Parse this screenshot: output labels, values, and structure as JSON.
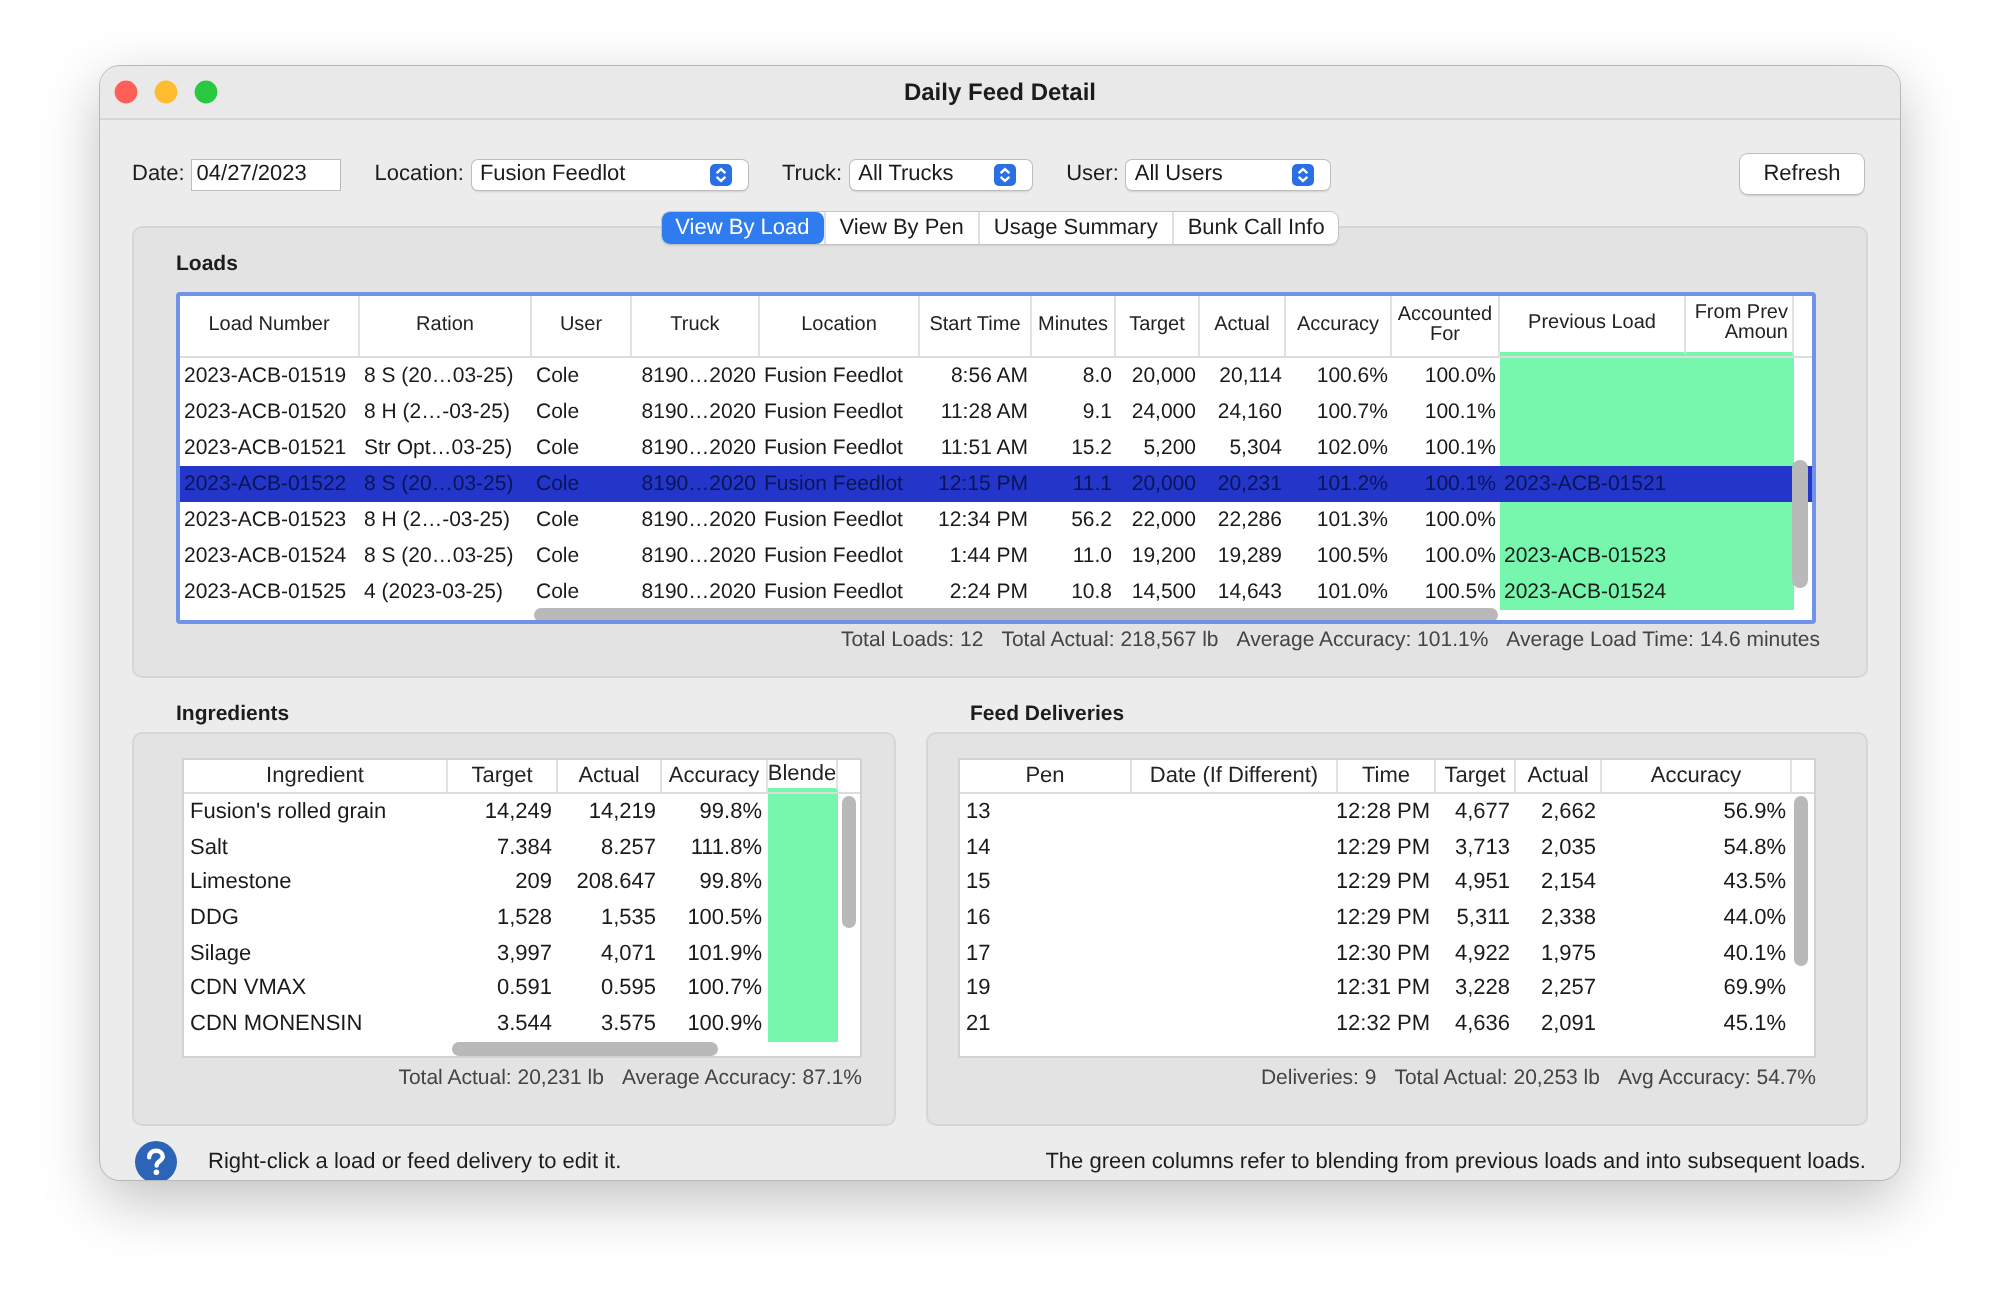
{
  "window": {
    "title": "Daily Feed Detail"
  },
  "filters": [
    {
      "kind": "field",
      "label": "Date:",
      "value": "04/27/2023"
    },
    {
      "kind": "popup",
      "label": "Location:",
      "value": "Fusion Feedlot"
    },
    {
      "kind": "popup",
      "label": "Truck:",
      "value": "All Trucks"
    },
    {
      "kind": "popup",
      "label": "User:",
      "value": "All Users"
    }
  ],
  "refresh_button": "Refresh",
  "tabs": [
    {
      "label": "View By Load",
      "selected": true
    },
    {
      "label": "View By Pen",
      "selected": false
    },
    {
      "label": "Usage Summary",
      "selected": false
    },
    {
      "label": "Bunk Call Info",
      "selected": false
    }
  ],
  "loads": {
    "title": "Loads",
    "columns": [
      {
        "label": "Load Number",
        "blend": false
      },
      {
        "label": "Ration",
        "blend": false
      },
      {
        "label": "User",
        "blend": false
      },
      {
        "label": "Truck",
        "blend": false
      },
      {
        "label": "Location",
        "blend": false
      },
      {
        "label": "Start Time",
        "blend": false
      },
      {
        "label": "Minutes",
        "blend": false
      },
      {
        "label": "Target",
        "blend": false
      },
      {
        "label": "Actual",
        "blend": false
      },
      {
        "label": "Accuracy",
        "blend": false
      },
      {
        "label": "Accounted For",
        "blend": false
      },
      {
        "label": "Previous Load",
        "blend": true
      },
      {
        "label": "From Prev Amoun",
        "blend": true
      }
    ],
    "rows": [
      {
        "selected": false,
        "cells": [
          "2023-ACB-01519",
          "8 S (20…03-25)",
          "Cole",
          "8190…2020",
          "Fusion Feedlot",
          "8:56 AM",
          "8.0",
          "20,000",
          "20,114",
          "100.6%",
          "100.0%",
          null,
          null
        ]
      },
      {
        "selected": false,
        "cells": [
          "2023-ACB-01520",
          "8 H (2…-03-25)",
          "Cole",
          "8190…2020",
          "Fusion Feedlot",
          "11:28 AM",
          "9.1",
          "24,000",
          "24,160",
          "100.7%",
          "100.1%",
          null,
          null
        ]
      },
      {
        "selected": false,
        "cells": [
          "2023-ACB-01521",
          "Str Opt…03-25)",
          "Cole",
          "8190…2020",
          "Fusion Feedlot",
          "11:51 AM",
          "15.2",
          "5,200",
          "5,304",
          "102.0%",
          "100.1%",
          null,
          null
        ]
      },
      {
        "selected": true,
        "cells": [
          "2023-ACB-01522",
          "8 S (20…03-25)",
          "Cole",
          "8190…2020",
          "Fusion Feedlot",
          "12:15 PM",
          "11.1",
          "20,000",
          "20,231",
          "101.2%",
          "100.1%",
          "2023-ACB-01521",
          null
        ]
      },
      {
        "selected": false,
        "cells": [
          "2023-ACB-01523",
          "8 H (2…-03-25)",
          "Cole",
          "8190…2020",
          "Fusion Feedlot",
          "12:34 PM",
          "56.2",
          "22,000",
          "22,286",
          "101.3%",
          "100.0%",
          null,
          null
        ]
      },
      {
        "selected": false,
        "cells": [
          "2023-ACB-01524",
          "8 S (20…03-25)",
          "Cole",
          "8190…2020",
          "Fusion Feedlot",
          "1:44 PM",
          "11.0",
          "19,200",
          "19,289",
          "100.5%",
          "100.0%",
          "2023-ACB-01523",
          null
        ]
      },
      {
        "selected": false,
        "cells": [
          "2023-ACB-01525",
          "4 (2023-03-25)",
          "Cole",
          "8190…2020",
          "Fusion Feedlot",
          "2:24 PM",
          "10.8",
          "14,500",
          "14,643",
          "101.0%",
          "100.5%",
          "2023-ACB-01524",
          null
        ]
      }
    ],
    "summary": [
      "Total Loads: 12",
      "Total Actual: 218,567 lb",
      "Average Accuracy: 101.1%",
      "Average Load Time: 14.6 minutes"
    ]
  },
  "ingredients": {
    "title": "Ingredients",
    "columns": [
      {
        "label": "Ingredient",
        "blend": false
      },
      {
        "label": "Target",
        "blend": false
      },
      {
        "label": "Actual",
        "blend": false
      },
      {
        "label": "Accuracy",
        "blend": false
      },
      {
        "label": "Blende",
        "blend": true
      }
    ],
    "rows": [
      {
        "selected": false,
        "cells": [
          "Fusion's rolled grain",
          "14,249",
          "14,219",
          "99.8%",
          null
        ]
      },
      {
        "selected": false,
        "cells": [
          "Salt",
          "7.384",
          "8.257",
          "111.8%",
          null
        ]
      },
      {
        "selected": false,
        "cells": [
          "Limestone",
          "209",
          "208.647",
          "99.8%",
          null
        ]
      },
      {
        "selected": false,
        "cells": [
          "DDG",
          "1,528",
          "1,535",
          "100.5%",
          null
        ]
      },
      {
        "selected": false,
        "cells": [
          "Silage",
          "3,997",
          "4,071",
          "101.9%",
          null
        ]
      },
      {
        "selected": false,
        "cells": [
          "CDN VMAX",
          "0.591",
          "0.595",
          "100.7%",
          null
        ]
      },
      {
        "selected": false,
        "cells": [
          "CDN MONENSIN",
          "3.544",
          "3.575",
          "100.9%",
          null
        ]
      }
    ],
    "summary": [
      "Total Actual: 20,231 lb",
      "Average Accuracy: 87.1%"
    ]
  },
  "feed_deliveries": {
    "title": "Feed Deliveries",
    "columns": [
      {
        "label": "Pen",
        "blend": false
      },
      {
        "label": "Date (If Different)",
        "blend": false
      },
      {
        "label": "Time",
        "blend": false
      },
      {
        "label": "Target",
        "blend": false
      },
      {
        "label": "Actual",
        "blend": false
      },
      {
        "label": "Accuracy",
        "blend": false
      }
    ],
    "rows": [
      {
        "selected": false,
        "cells": [
          "13",
          null,
          "12:28 PM",
          "4,677",
          "2,662",
          "56.9%"
        ]
      },
      {
        "selected": false,
        "cells": [
          "14",
          null,
          "12:29 PM",
          "3,713",
          "2,035",
          "54.8%"
        ]
      },
      {
        "selected": false,
        "cells": [
          "15",
          null,
          "12:29 PM",
          "4,951",
          "2,154",
          "43.5%"
        ]
      },
      {
        "selected": false,
        "cells": [
          "16",
          null,
          "12:29 PM",
          "5,311",
          "2,338",
          "44.0%"
        ]
      },
      {
        "selected": false,
        "cells": [
          "17",
          null,
          "12:30 PM",
          "4,922",
          "1,975",
          "40.1%"
        ]
      },
      {
        "selected": false,
        "cells": [
          "19",
          null,
          "12:31 PM",
          "3,228",
          "2,257",
          "69.9%"
        ]
      },
      {
        "selected": false,
        "cells": [
          "21",
          null,
          "12:32 PM",
          "4,636",
          "2,091",
          "45.1%"
        ]
      }
    ],
    "summary": [
      "Deliveries: 9",
      "Total Actual: 20,253 lb",
      "Avg Accuracy: 54.7%"
    ]
  },
  "footer": {
    "hint": "Right-click a load or feed delivery to edit it.",
    "note": "The green columns refer to blending from previous loads and into subsequent loads."
  }
}
